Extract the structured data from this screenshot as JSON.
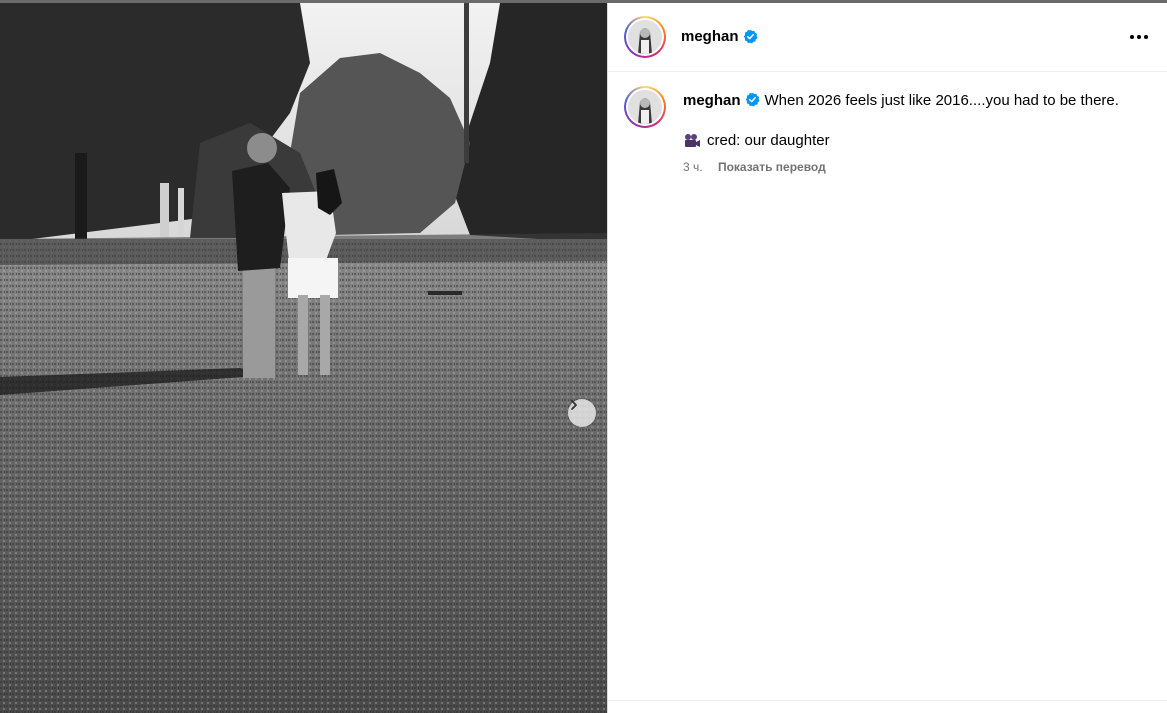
{
  "post": {
    "username": "meghan",
    "verified_icon": "verified-badge-icon",
    "more_icon": "more-options-icon",
    "caption": "When 2026 feels just like 2016....you had to be there.",
    "credit_icon": "video-camera-icon",
    "credit": "cred: our daughter",
    "time_ago": "3 ч.",
    "translate_label": "Показать перевод"
  },
  "media": {
    "description_icon": "photo",
    "next_icon": "chevron-right-icon"
  },
  "colors": {
    "verified": "#0095f6",
    "secondary_text": "#737373",
    "ring_gradient": [
      "#feda75",
      "#fa7e1e",
      "#d62976",
      "#962fbf",
      "#4f5bd5"
    ]
  }
}
